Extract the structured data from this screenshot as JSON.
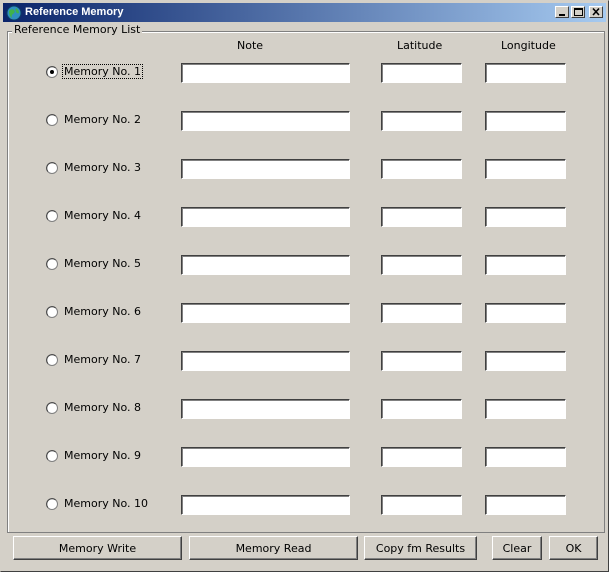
{
  "window": {
    "title": "Reference Memory",
    "icon": "app-globe-icon"
  },
  "group": {
    "label": "Reference Memory List"
  },
  "columns": {
    "note": "Note",
    "latitude": "Latitude",
    "longitude": "Longitude"
  },
  "rows": [
    {
      "label": "Memory No. 1",
      "selected": true,
      "note": "",
      "latitude": "",
      "longitude": ""
    },
    {
      "label": "Memory No. 2",
      "selected": false,
      "note": "",
      "latitude": "",
      "longitude": ""
    },
    {
      "label": "Memory No. 3",
      "selected": false,
      "note": "",
      "latitude": "",
      "longitude": ""
    },
    {
      "label": "Memory No. 4",
      "selected": false,
      "note": "",
      "latitude": "",
      "longitude": ""
    },
    {
      "label": "Memory No. 5",
      "selected": false,
      "note": "",
      "latitude": "",
      "longitude": ""
    },
    {
      "label": "Memory No. 6",
      "selected": false,
      "note": "",
      "latitude": "",
      "longitude": ""
    },
    {
      "label": "Memory No. 7",
      "selected": false,
      "note": "",
      "latitude": "",
      "longitude": ""
    },
    {
      "label": "Memory No. 8",
      "selected": false,
      "note": "",
      "latitude": "",
      "longitude": ""
    },
    {
      "label": "Memory No. 9",
      "selected": false,
      "note": "",
      "latitude": "",
      "longitude": ""
    },
    {
      "label": "Memory No. 10",
      "selected": false,
      "note": "",
      "latitude": "",
      "longitude": ""
    }
  ],
  "buttons": {
    "memory_write": "Memory Write",
    "memory_read": "Memory Read",
    "copy_results": "Copy fm Results",
    "clear": "Clear",
    "ok": "OK"
  },
  "colors": {
    "title_start": "#0a246a",
    "title_end": "#a6caf0",
    "face": "#d4d0c8"
  }
}
